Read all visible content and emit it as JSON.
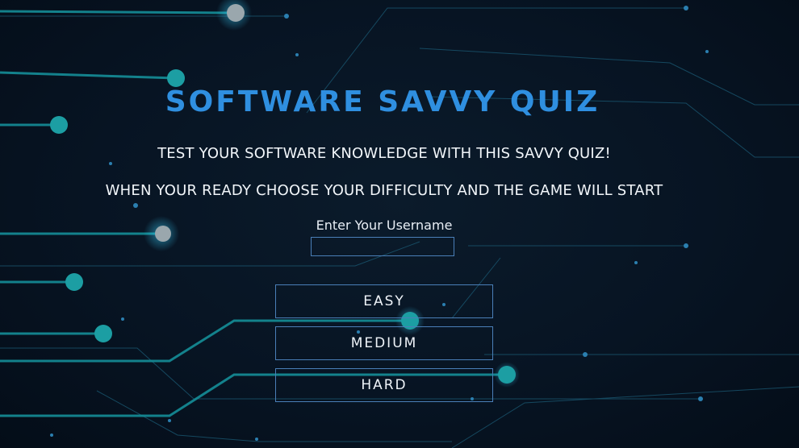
{
  "title": "SOFTWARE SAVVY QUIZ",
  "tagline": "TEST YOUR SOFTWARE KNOWLEDGE WITH THIS SAVVY QUIZ!",
  "instructions": "WHEN YOUR READY CHOOSE YOUR DIFFICULTY AND THE GAME WILL START",
  "username": {
    "label": "Enter Your Username",
    "value": ""
  },
  "difficulty_buttons": {
    "easy": "EASY",
    "medium": "MEDIUM",
    "hard": "HARD"
  },
  "colors": {
    "background": "#06121f",
    "title": "#2f8fe0",
    "text": "#f2f6fa",
    "border": "#4a7fb8",
    "circuit_line": "#1aa3a8",
    "circuit_dot": "#2ec4c4"
  }
}
